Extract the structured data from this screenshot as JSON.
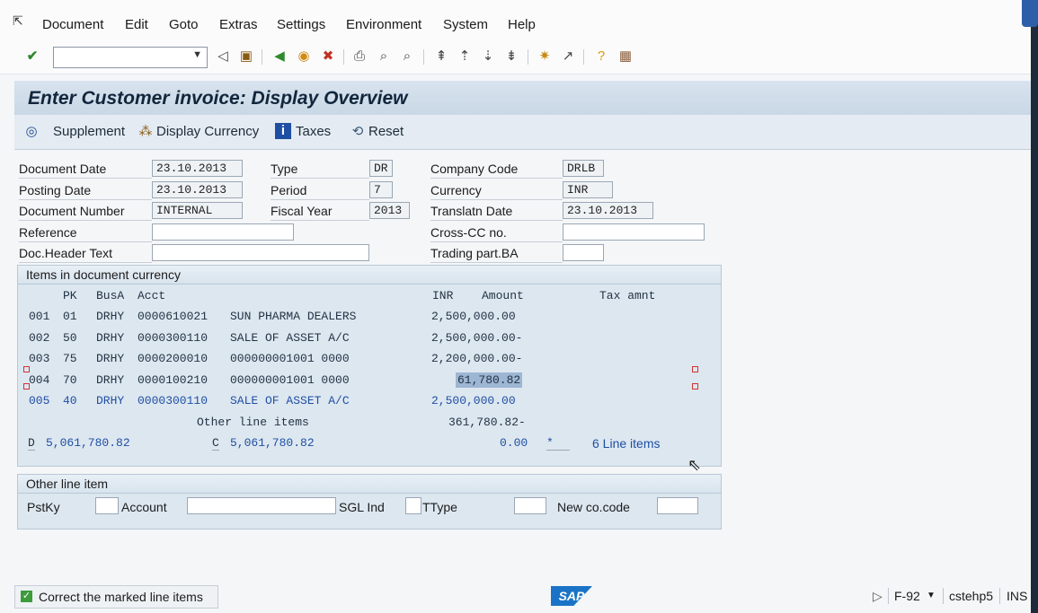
{
  "menu": [
    "Document",
    "Edit",
    "Goto",
    "Extras",
    "Settings",
    "Environment",
    "System",
    "Help"
  ],
  "title": "Enter Customer invoice: Display Overview",
  "app_toolbar": {
    "supplement": "Supplement",
    "display_currency": "Display Currency",
    "taxes": "Taxes",
    "reset": "Reset"
  },
  "header": {
    "doc_date_label": "Document Date",
    "doc_date": "23.10.2013",
    "posting_date_label": "Posting Date",
    "posting_date": "23.10.2013",
    "doc_number_label": "Document Number",
    "doc_number": "INTERNAL",
    "reference_label": "Reference",
    "reference": "",
    "doc_header_label": "Doc.Header Text",
    "doc_header": "",
    "type_label": "Type",
    "type": "DR",
    "period_label": "Period",
    "period": "7",
    "fiscal_year_label": "Fiscal Year",
    "fiscal_year": "2013",
    "company_code_label": "Company Code",
    "company_code": "DRLB",
    "currency_label": "Currency",
    "currency": "INR",
    "translatn_date_label": "Translatn Date",
    "translatn_date": "23.10.2013",
    "cross_cc_label": "Cross-CC no.",
    "cross_cc": "",
    "trading_part_label": "Trading part.BA",
    "trading_part": ""
  },
  "items": {
    "title": "Items in document currency",
    "col_pk": "PK",
    "col_busa": "BusA",
    "col_acct": "Acct",
    "col_inr": "INR",
    "col_amount": "Amount",
    "col_tax": "Tax amnt",
    "rows": [
      {
        "no": "001",
        "pk": "01",
        "busa": "DRHY",
        "acct": "0000610021",
        "text": "SUN PHARMA DEALERS",
        "amount": "2,500,000.00"
      },
      {
        "no": "002",
        "pk": "50",
        "busa": "DRHY",
        "acct": "0000300110",
        "text": "SALE OF ASSET A/C",
        "amount": "2,500,000.00-"
      },
      {
        "no": "003",
        "pk": "75",
        "busa": "DRHY",
        "acct": "0000200010",
        "text": "000000001001 0000",
        "amount": "2,200,000.00-"
      },
      {
        "no": "004",
        "pk": "70",
        "busa": "DRHY",
        "acct": "0000100210",
        "text": "000000001001 0000",
        "amount": "61,780.82"
      },
      {
        "no": "005",
        "pk": "40",
        "busa": "DRHY",
        "acct": "0000300110",
        "text": "SALE OF ASSET A/C",
        "amount": "2,500,000.00"
      }
    ],
    "other_label": "Other line items",
    "other_amount": "361,780.82-",
    "debit_prefix": "D",
    "debit": "5,061,780.82",
    "credit_prefix": "C",
    "credit": "5,061,780.82",
    "balance": "0.00",
    "star": "*",
    "line_items": "6 Line items"
  },
  "other_line": {
    "title": "Other line item",
    "pstky_label": "PstKy",
    "account_label": "Account",
    "sgl_label": "SGL Ind",
    "ttype_label": "TType",
    "newco_label": "New co.code"
  },
  "status": {
    "message": "Correct the marked line items",
    "sap": "SAP",
    "transaction": "F-92",
    "server": "cstehp5",
    "mode": "INS"
  }
}
